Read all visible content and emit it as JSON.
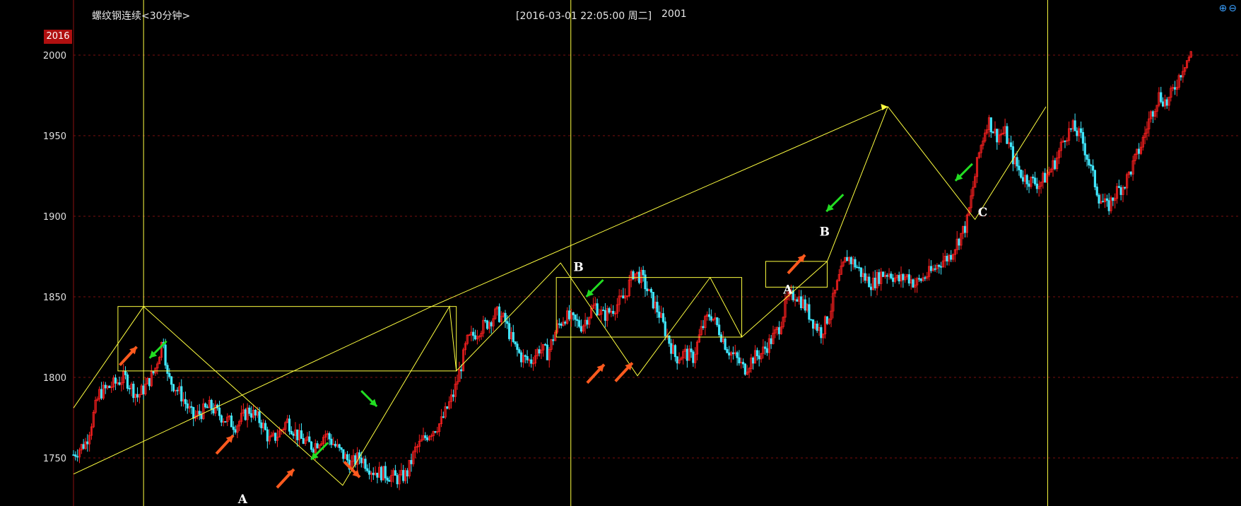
{
  "header": {
    "title": "螺纹钢连续<30分钟>",
    "datetime": "[2016-03-01  22:05:00 周二]",
    "price": "2001"
  },
  "price_badge": "2016",
  "zoom": {
    "in_icon": "zoom-in-icon",
    "out_icon": "zoom-out-icon"
  },
  "colors": {
    "background": "#000000",
    "up_candle": "#ff2020",
    "down_candle": "#40e8ff",
    "drawing": "#ffff40",
    "grid": "#7a1010",
    "axis_text": "#e0e0e0",
    "arrow_orange": "#ff5a1e",
    "arrow_green": "#22dd22"
  },
  "chart_data": {
    "type": "candlestick",
    "ylim": [
      1725,
      2030
    ],
    "yticks": [
      1750,
      1800,
      1850,
      1900,
      1950,
      2000
    ],
    "x_range": [
      0,
      100
    ],
    "close_path": [
      [
        0,
        1752
      ],
      [
        1.5,
        1760
      ],
      [
        3,
        1790
      ],
      [
        4.5,
        1795
      ],
      [
        6,
        1800
      ],
      [
        7.5,
        1788
      ],
      [
        8.5,
        1795
      ],
      [
        9.5,
        1804
      ],
      [
        10.5,
        1825
      ],
      [
        11,
        1800
      ],
      [
        12.5,
        1790
      ],
      [
        14,
        1775
      ],
      [
        16,
        1782
      ],
      [
        17.5,
        1775
      ],
      [
        19,
        1770
      ],
      [
        20.5,
        1780
      ],
      [
        22,
        1772
      ],
      [
        23,
        1760
      ],
      [
        24,
        1765
      ],
      [
        25,
        1773
      ],
      [
        26.5,
        1762
      ],
      [
        28,
        1757
      ],
      [
        29.5,
        1765
      ],
      [
        31,
        1755
      ],
      [
        32.5,
        1746
      ],
      [
        33.5,
        1751
      ],
      [
        35,
        1742
      ],
      [
        36.5,
        1740
      ],
      [
        38,
        1737
      ],
      [
        39,
        1740
      ],
      [
        40,
        1755
      ],
      [
        41.5,
        1765
      ],
      [
        43,
        1772
      ],
      [
        44.5,
        1790
      ],
      [
        45.5,
        1810
      ],
      [
        46,
        1822
      ],
      [
        47.5,
        1830
      ],
      [
        48.5,
        1834
      ],
      [
        49.5,
        1840
      ],
      [
        50.5,
        1835
      ],
      [
        51.5,
        1820
      ],
      [
        52.5,
        1812
      ],
      [
        53.5,
        1810
      ],
      [
        54.5,
        1818
      ],
      [
        55.5,
        1815
      ],
      [
        56.5,
        1830
      ],
      [
        57.5,
        1838
      ],
      [
        58.5,
        1835
      ],
      [
        59.5,
        1832
      ],
      [
        61,
        1845
      ],
      [
        62,
        1838
      ],
      [
        63,
        1842
      ],
      [
        64.5,
        1850
      ],
      [
        65.5,
        1865
      ],
      [
        66.5,
        1862
      ],
      [
        67.5,
        1850
      ],
      [
        68.5,
        1840
      ],
      [
        69.5,
        1825
      ],
      [
        70.5,
        1812
      ],
      [
        71.5,
        1815
      ],
      [
        72.5,
        1812
      ],
      [
        73.5,
        1830
      ],
      [
        74.5,
        1840
      ],
      [
        75.5,
        1830
      ],
      [
        76.5,
        1818
      ],
      [
        77.5,
        1812
      ],
      [
        78.5,
        1805
      ],
      [
        79.5,
        1812
      ],
      [
        80.5,
        1815
      ],
      [
        81.5,
        1822
      ],
      [
        82.5,
        1830
      ],
      [
        83.5,
        1848
      ],
      [
        84.5,
        1852
      ],
      [
        85.5,
        1845
      ],
      [
        86.5,
        1835
      ],
      [
        87.5,
        1828
      ],
      [
        88.5,
        1840
      ],
      [
        89.5,
        1860
      ],
      [
        90.5,
        1875
      ],
      [
        91.5,
        1870
      ],
      [
        92.5,
        1862
      ],
      [
        93.5,
        1858
      ],
      [
        94.5,
        1864
      ],
      [
        95.5,
        1865
      ],
      [
        96.5,
        1860
      ],
      [
        97.5,
        1863
      ],
      [
        98.5,
        1858
      ],
      [
        99.5,
        1862
      ],
      [
        100.5,
        1866
      ],
      [
        101.5,
        1872
      ],
      [
        102.5,
        1875
      ],
      [
        103.5,
        1885
      ],
      [
        104.5,
        1895
      ],
      [
        105,
        1910
      ],
      [
        106,
        1940
      ],
      [
        107,
        1960
      ],
      [
        108,
        1950
      ],
      [
        109,
        1952
      ],
      [
        110,
        1935
      ],
      [
        111,
        1925
      ],
      [
        112,
        1922
      ],
      [
        113,
        1920
      ],
      [
        114,
        1926
      ],
      [
        115,
        1935
      ],
      [
        116,
        1950
      ],
      [
        117,
        1955
      ],
      [
        118,
        1948
      ],
      [
        119,
        1930
      ],
      [
        120,
        1912
      ],
      [
        121,
        1905
      ],
      [
        122,
        1915
      ],
      [
        123,
        1920
      ],
      [
        124,
        1932
      ],
      [
        125,
        1945
      ],
      [
        126,
        1962
      ],
      [
        127,
        1975
      ],
      [
        128,
        1970
      ],
      [
        129,
        1982
      ],
      [
        130,
        1995
      ],
      [
        131,
        2002
      ]
    ],
    "x_max": 131,
    "drawings": {
      "boxes": [
        {
          "x1": 5.2,
          "y1": 1804,
          "x2": 44.8,
          "y2": 1844
        },
        {
          "x1": 56.5,
          "y1": 1825,
          "x2": 78.2,
          "y2": 1862
        },
        {
          "x1": 81.0,
          "y1": 1856,
          "x2": 88.2,
          "y2": 1872
        }
      ],
      "lines": [
        [
          [
            0,
            1781
          ],
          [
            8.2,
            1844
          ],
          [
            31.5,
            1733
          ],
          [
            44,
            1844
          ],
          [
            44.8,
            1804
          ],
          [
            57,
            1871
          ],
          [
            66,
            1801
          ],
          [
            74.5,
            1862
          ],
          [
            78.2,
            1825
          ],
          [
            88.2,
            1872
          ],
          [
            95.3,
            1968
          ],
          [
            105.5,
            1898
          ],
          [
            113.8,
            1968
          ]
        ],
        [
          [
            0,
            1740
          ],
          [
            41.9,
            1844
          ],
          [
            95.3,
            1968
          ]
        ]
      ],
      "end_arrow": [
        95.3,
        1968
      ],
      "arrows": [
        {
          "x": 7.4,
          "y": 1819,
          "dir": "up",
          "color": "orange"
        },
        {
          "x": 8.9,
          "y": 1812,
          "dir": "down",
          "color": "green"
        },
        {
          "x": 18.7,
          "y": 1764,
          "dir": "up",
          "color": "orange"
        },
        {
          "x": 25.8,
          "y": 1743,
          "dir": "up",
          "color": "orange"
        },
        {
          "x": 27.8,
          "y": 1749,
          "dir": "down",
          "color": "green"
        },
        {
          "x": 33.5,
          "y": 1738,
          "dir": "down-right",
          "color": "orange"
        },
        {
          "x": 35.5,
          "y": 1782,
          "dir": "right-down",
          "color": "green"
        },
        {
          "x": 60.0,
          "y": 1850,
          "dir": "down",
          "color": "green"
        },
        {
          "x": 62.1,
          "y": 1808,
          "dir": "up",
          "color": "orange"
        },
        {
          "x": 65.4,
          "y": 1809,
          "dir": "up",
          "color": "orange"
        },
        {
          "x": 85.6,
          "y": 1876,
          "dir": "up",
          "color": "orange"
        },
        {
          "x": 88.1,
          "y": 1903,
          "dir": "down",
          "color": "green"
        },
        {
          "x": 103.2,
          "y": 1922,
          "dir": "down",
          "color": "green"
        }
      ],
      "letters": [
        {
          "text": "A",
          "x": 19.8,
          "y": 1722
        },
        {
          "text": "B",
          "x": 59.1,
          "y": 1866
        },
        {
          "text": "A",
          "x": 83.6,
          "y": 1852
        },
        {
          "text": "B",
          "x": 87.9,
          "y": 1888
        },
        {
          "text": "C",
          "x": 106.4,
          "y": 1900
        }
      ]
    },
    "vlines": [
      8.2,
      58.2,
      114.0
    ]
  }
}
